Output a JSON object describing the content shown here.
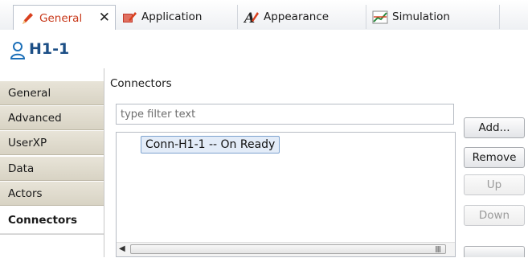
{
  "tabs": [
    {
      "label": "General",
      "icon": "pencil-icon",
      "active": true,
      "close": "✕"
    },
    {
      "label": "Application",
      "icon": "application-icon",
      "active": false
    },
    {
      "label": "Appearance",
      "icon": "appearance-icon",
      "active": false
    },
    {
      "label": "Simulation",
      "icon": "simulation-chart-icon",
      "active": false
    }
  ],
  "header": {
    "title": "H1-1",
    "icon": "person-icon"
  },
  "nav": {
    "items": [
      {
        "label": "General"
      },
      {
        "label": "Advanced"
      },
      {
        "label": "UserXP"
      },
      {
        "label": "Data"
      },
      {
        "label": "Actors"
      },
      {
        "label": "Connectors",
        "selected": true
      }
    ]
  },
  "main": {
    "section_label": "Connectors",
    "filter_placeholder": "type filter text",
    "filter_value": "",
    "list_items": [
      "Conn-H1-1 -- On Ready"
    ],
    "scroll_grip": "III",
    "buttons": {
      "add": "Add...",
      "remove": "Remove",
      "up": "Up",
      "down": "Down"
    }
  },
  "colors": {
    "accent": "#1c4f86",
    "selection": "#e3ecf8",
    "nav_bg": "#d8d3c4"
  }
}
